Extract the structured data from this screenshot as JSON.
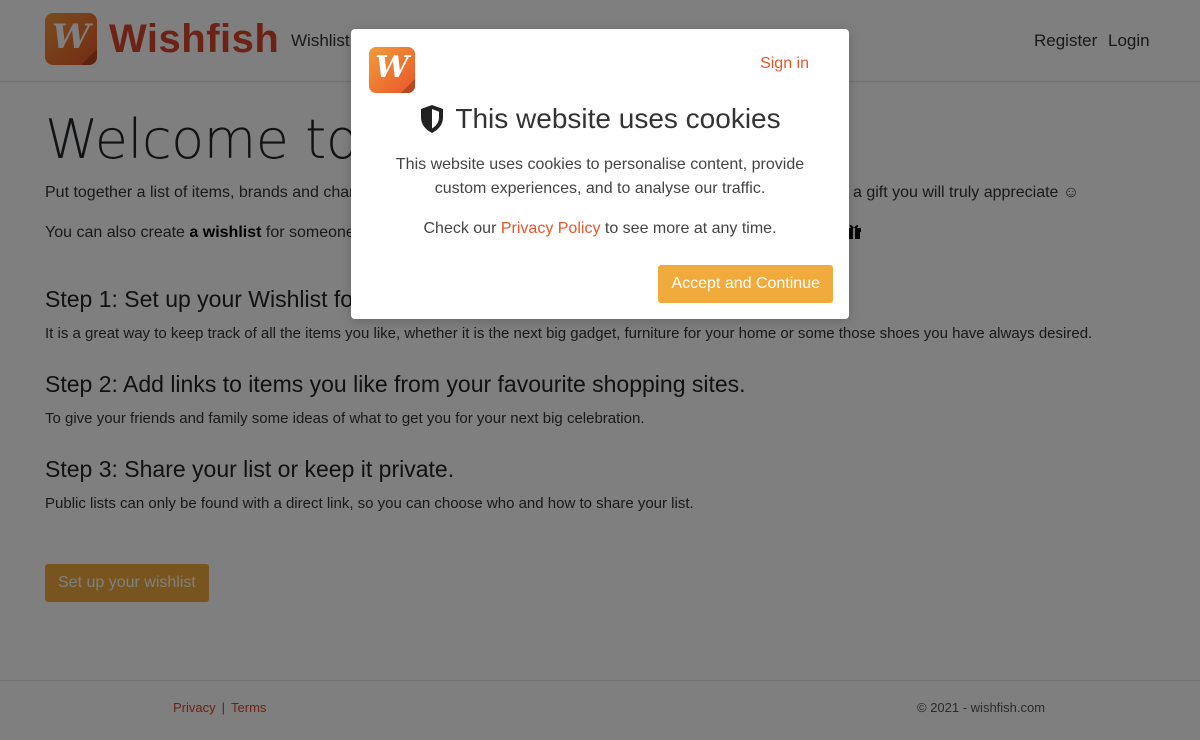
{
  "header": {
    "brand_letter": "W",
    "brand_name": "Wishfish",
    "nav_wishlist": "Wishlist",
    "nav_register": "Register",
    "nav_login": "Login",
    "brand_color": "#d9442a"
  },
  "main": {
    "welcome": "Welcome to",
    "intro1_left": "Put together a list of items, brands and char",
    "intro1_right": "a gift you will truly appreciate ☺",
    "intro2_prefix": "You can also create ",
    "intro2_bold": "a wishlist",
    "intro2_suffix": " for someone e",
    "gift_icon": "gift-icon",
    "step1_title": "Step 1: Set up your Wishlist fo",
    "step1_text": "It is a great way to keep track of all the items you like, whether it is the next big gadget, furniture for your home or some those shoes you have always desired.",
    "step2_title": "Step 2: Add links to items you like from your favourite shopping sites.",
    "step2_text": "To give your friends and family some ideas of what to get you for your next big celebration.",
    "step3_title": "Step 3: Share your list or keep it private.",
    "step3_text": "Public lists can only be found with a direct link, so you can choose who and how to share your list.",
    "setup_button": "Set up your wishlist"
  },
  "footer": {
    "privacy": "Privacy",
    "separator": "|",
    "terms": "Terms",
    "copyright": "© 2021 - wishfish.com"
  },
  "modal": {
    "logo_letter": "W",
    "sign_in": "Sign in",
    "title": "This website uses cookies",
    "text": "This website uses cookies to personalise content, provide custom experiences, and to analyse our traffic.",
    "policy_prefix": "Check our ",
    "policy_link": "Privacy Policy",
    "policy_suffix": " to see more at any time.",
    "accept_button": "Accept and Continue",
    "shield_icon": "shield-icon",
    "accent_color": "#f0ab3c"
  }
}
